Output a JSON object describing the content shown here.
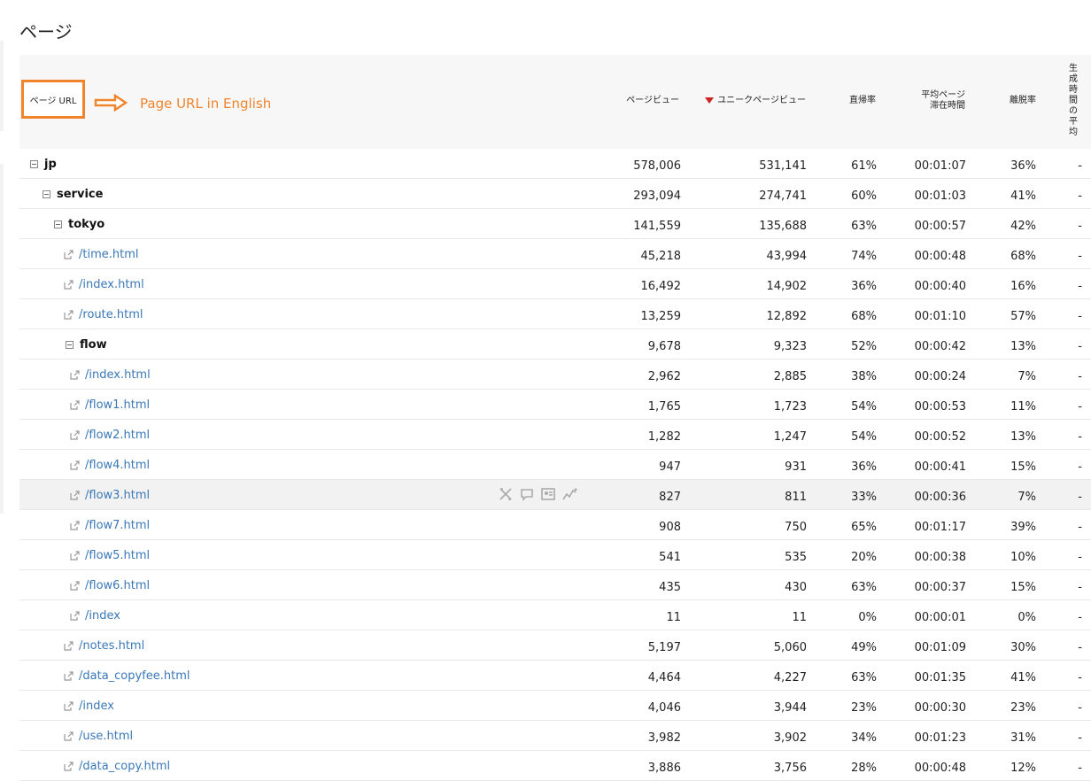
{
  "page": {
    "title": "ページ"
  },
  "annotation": {
    "text": "Page URL in English",
    "color": "#f0842c"
  },
  "header": {
    "url": "ページ URL",
    "pageviews": "ページビュー",
    "unique_pageviews": "ユニークページビュー",
    "entrance_rate": "直帰率",
    "avg_time_line1": "平均ページ",
    "avg_time_line2": "滞在時間",
    "exit_rate": "離脱率",
    "last_col": [
      "生",
      "成",
      "時",
      "間",
      "の",
      "平",
      "均"
    ]
  },
  "rows": [
    {
      "type": "folder",
      "level": 0,
      "label": "jp",
      "pv": "578,006",
      "upv": "531,141",
      "br": "61%",
      "time": "00:01:07",
      "ex": "36%",
      "last": "-"
    },
    {
      "type": "folder",
      "level": 1,
      "label": "service",
      "pv": "293,094",
      "upv": "274,741",
      "br": "60%",
      "time": "00:01:03",
      "ex": "41%",
      "last": "-"
    },
    {
      "type": "folder",
      "level": 2,
      "label": "tokyo",
      "pv": "141,559",
      "upv": "135,688",
      "br": "63%",
      "time": "00:00:57",
      "ex": "42%",
      "last": "-"
    },
    {
      "type": "link",
      "level": 3,
      "label": "/time.html",
      "pv": "45,218",
      "upv": "43,994",
      "br": "74%",
      "time": "00:00:48",
      "ex": "68%",
      "last": "-"
    },
    {
      "type": "link",
      "level": 3,
      "label": "/index.html",
      "pv": "16,492",
      "upv": "14,902",
      "br": "36%",
      "time": "00:00:40",
      "ex": "16%",
      "last": "-"
    },
    {
      "type": "link",
      "level": 3,
      "label": "/route.html",
      "pv": "13,259",
      "upv": "12,892",
      "br": "68%",
      "time": "00:01:10",
      "ex": "57%",
      "last": "-"
    },
    {
      "type": "folder",
      "level": 3,
      "label": "flow",
      "pv": "9,678",
      "upv": "9,323",
      "br": "52%",
      "time": "00:00:42",
      "ex": "13%",
      "last": "-"
    },
    {
      "type": "link",
      "level": 4,
      "label": "/index.html",
      "pv": "2,962",
      "upv": "2,885",
      "br": "38%",
      "time": "00:00:24",
      "ex": "7%",
      "last": "-"
    },
    {
      "type": "link",
      "level": 4,
      "label": "/flow1.html",
      "pv": "1,765",
      "upv": "1,723",
      "br": "54%",
      "time": "00:00:53",
      "ex": "11%",
      "last": "-"
    },
    {
      "type": "link",
      "level": 4,
      "label": "/flow2.html",
      "pv": "1,282",
      "upv": "1,247",
      "br": "54%",
      "time": "00:00:52",
      "ex": "13%",
      "last": "-"
    },
    {
      "type": "link",
      "level": 4,
      "label": "/flow4.html",
      "pv": "947",
      "upv": "931",
      "br": "36%",
      "time": "00:00:41",
      "ex": "15%",
      "last": "-"
    },
    {
      "type": "link",
      "level": 4,
      "label": "/flow3.html",
      "pv": "827",
      "upv": "811",
      "br": "33%",
      "time": "00:00:36",
      "ex": "7%",
      "last": "-",
      "hover": true
    },
    {
      "type": "link",
      "level": 4,
      "label": "/flow7.html",
      "pv": "908",
      "upv": "750",
      "br": "65%",
      "time": "00:01:17",
      "ex": "39%",
      "last": "-"
    },
    {
      "type": "link",
      "level": 4,
      "label": "/flow5.html",
      "pv": "541",
      "upv": "535",
      "br": "20%",
      "time": "00:00:38",
      "ex": "10%",
      "last": "-"
    },
    {
      "type": "link",
      "level": 4,
      "label": "/flow6.html",
      "pv": "435",
      "upv": "430",
      "br": "63%",
      "time": "00:00:37",
      "ex": "15%",
      "last": "-"
    },
    {
      "type": "link",
      "level": 4,
      "label": "/index",
      "pv": "11",
      "upv": "11",
      "br": "0%",
      "time": "00:00:01",
      "ex": "0%",
      "last": "-"
    },
    {
      "type": "link",
      "level": 3,
      "label": "/notes.html",
      "pv": "5,197",
      "upv": "5,060",
      "br": "49%",
      "time": "00:01:09",
      "ex": "30%",
      "last": "-"
    },
    {
      "type": "link",
      "level": 3,
      "label": "/data_copyfee.html",
      "pv": "4,464",
      "upv": "4,227",
      "br": "63%",
      "time": "00:01:35",
      "ex": "41%",
      "last": "-"
    },
    {
      "type": "link",
      "level": 3,
      "label": "/index",
      "pv": "4,046",
      "upv": "3,944",
      "br": "23%",
      "time": "00:00:30",
      "ex": "23%",
      "last": "-"
    },
    {
      "type": "link",
      "level": 3,
      "label": "/use.html",
      "pv": "3,982",
      "upv": "3,902",
      "br": "34%",
      "time": "00:01:23",
      "ex": "31%",
      "last": "-"
    },
    {
      "type": "link",
      "level": 3,
      "label": "/data_copy.html",
      "pv": "3,886",
      "upv": "3,756",
      "br": "28%",
      "time": "00:00:48",
      "ex": "12%",
      "last": "-"
    }
  ],
  "row_action_icons": [
    "compare-icon",
    "comment-icon",
    "profile-card-icon",
    "trend-line-icon"
  ]
}
